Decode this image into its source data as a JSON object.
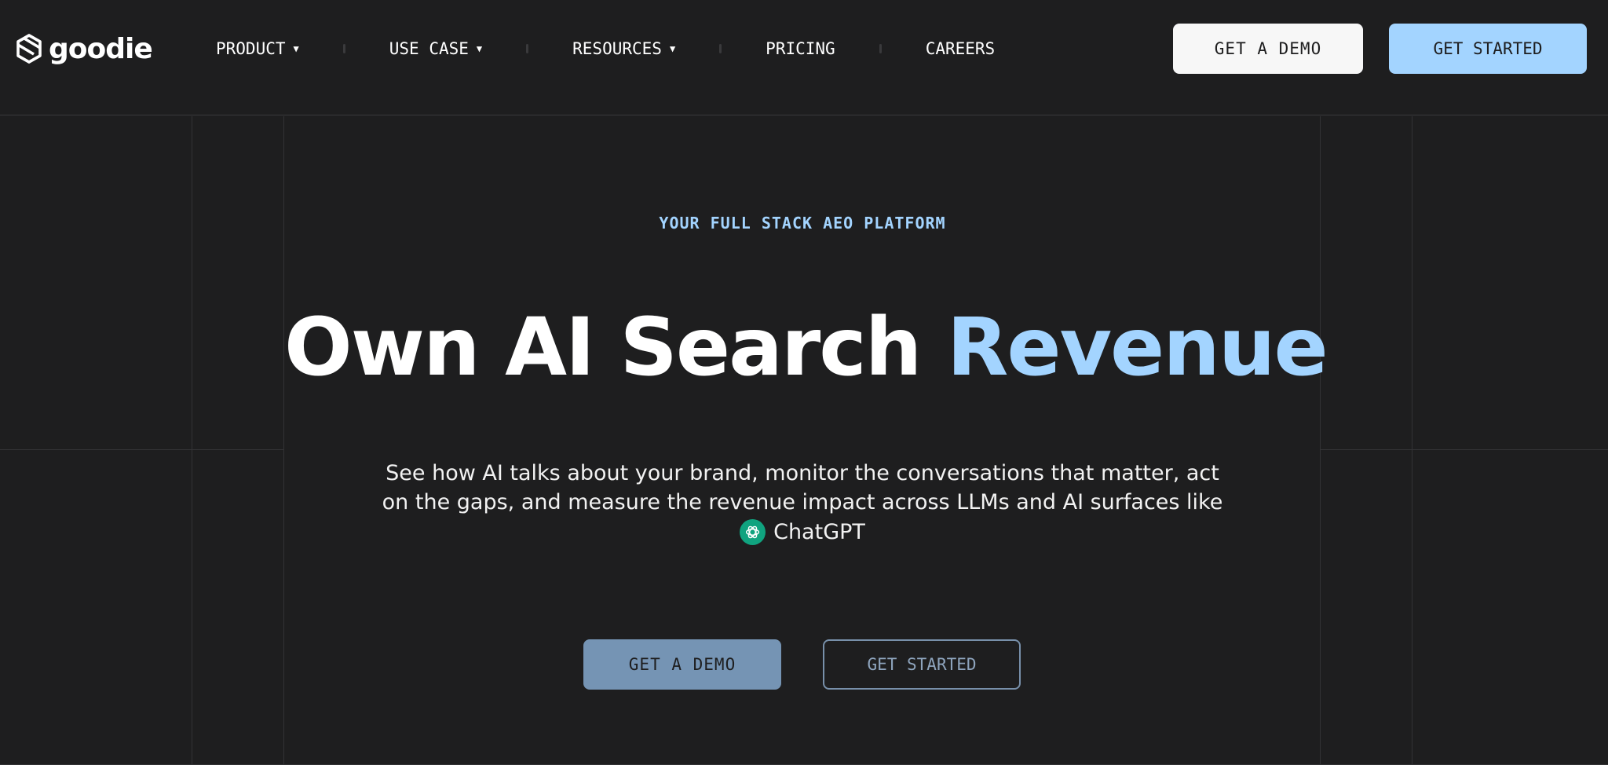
{
  "nav": {
    "logo_text": "goodie",
    "links": [
      {
        "label": "PRODUCT",
        "dropdown": true
      },
      {
        "label": "USE CASE",
        "dropdown": true
      },
      {
        "label": "RESOURCES",
        "dropdown": true
      },
      {
        "label": "PRICING",
        "dropdown": false
      },
      {
        "label": "CAREERS",
        "dropdown": false
      }
    ],
    "caret": "▼",
    "demo_button": "GET A DEMO",
    "start_button": "GET STARTED"
  },
  "hero": {
    "eyebrow": "YOUR FULL STACK AEO PLATFORM",
    "headline_main": "Own AI Search",
    "headline_accent": "Revenue",
    "subtext": "See how AI talks about your brand, monitor the conversations that matter, act on the gaps, and measure the revenue impact across LLMs and AI surfaces like",
    "llm_name": "ChatGPT",
    "demo_button": "GET A DEMO",
    "start_button": "GET STARTED"
  },
  "colors": {
    "background": "#1e1e1f",
    "accent": "#a3d4ff",
    "chatgpt_green": "#10a37f"
  },
  "icons": {
    "logo": "goodie-logo-icon",
    "llm": "chatgpt-icon"
  }
}
